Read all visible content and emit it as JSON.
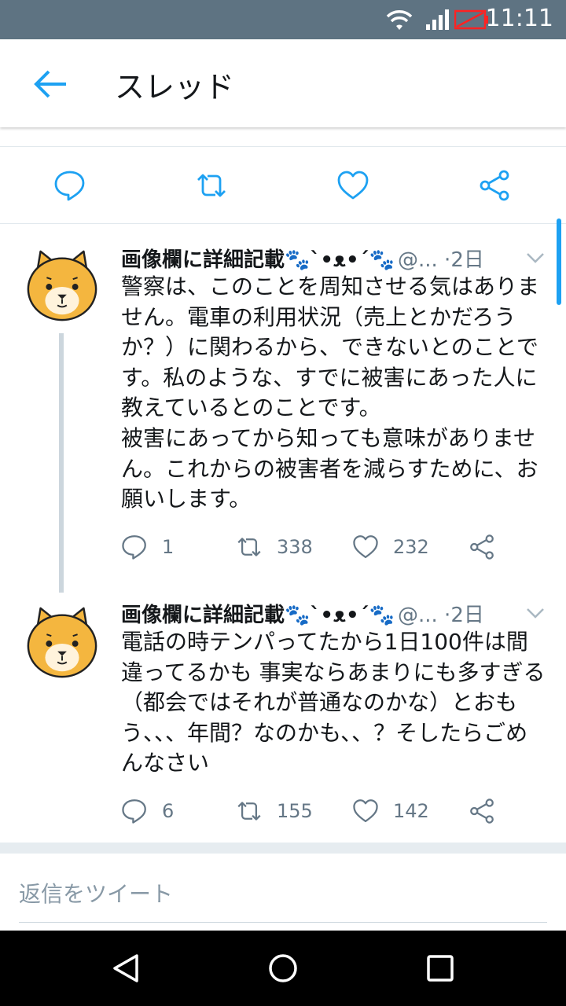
{
  "status_bar": {
    "time": "11:11",
    "icons": [
      "wifi-icon",
      "signal-icon",
      "battery-empty-icon"
    ]
  },
  "header": {
    "back_icon": "back-arrow-icon",
    "title": "スレッド"
  },
  "top_actions": [
    "reply-icon",
    "retweet-icon",
    "like-icon",
    "share-icon"
  ],
  "tweets": [
    {
      "display_name": "画像欄に詳細記載🐾ˋ•ᴥ•ˊ🐾",
      "handle": "@...",
      "dot": "·",
      "date": "2日",
      "text": "警察は、このことを周知させる気はありません。電車の利用状況（売上とかだろうか？）に関わるから、できないとのことです。私のような、すでに被害にあった人に教えているとのことです。\n被害にあってから知っても意味がありません。これからの被害者を減らすために、お願いします。",
      "replies": "1",
      "retweets": "338",
      "likes": "232"
    },
    {
      "display_name": "画像欄に詳細記載🐾ˋ•ᴥ•ˊ🐾",
      "handle": "@...",
      "dot": "·",
      "date": "2日",
      "text": "電話の時テンパってたから1日100件は間違ってるかも 事実ならあまりにも多すぎる（都会ではそれが普通なのかな）とおもう、、、年間？なのかも、、？そしたらごめんなさい",
      "replies": "6",
      "retweets": "155",
      "likes": "142"
    }
  ],
  "reply_bar": {
    "placeholder": "返信をツイート"
  },
  "nav_bar": [
    "back-triangle-icon",
    "home-circle-icon",
    "recents-square-icon"
  ],
  "colors": {
    "status_bar": "#5e7382",
    "accent": "#1da1f2",
    "secondary_text": "#657786",
    "divider": "#e1e8ed"
  }
}
